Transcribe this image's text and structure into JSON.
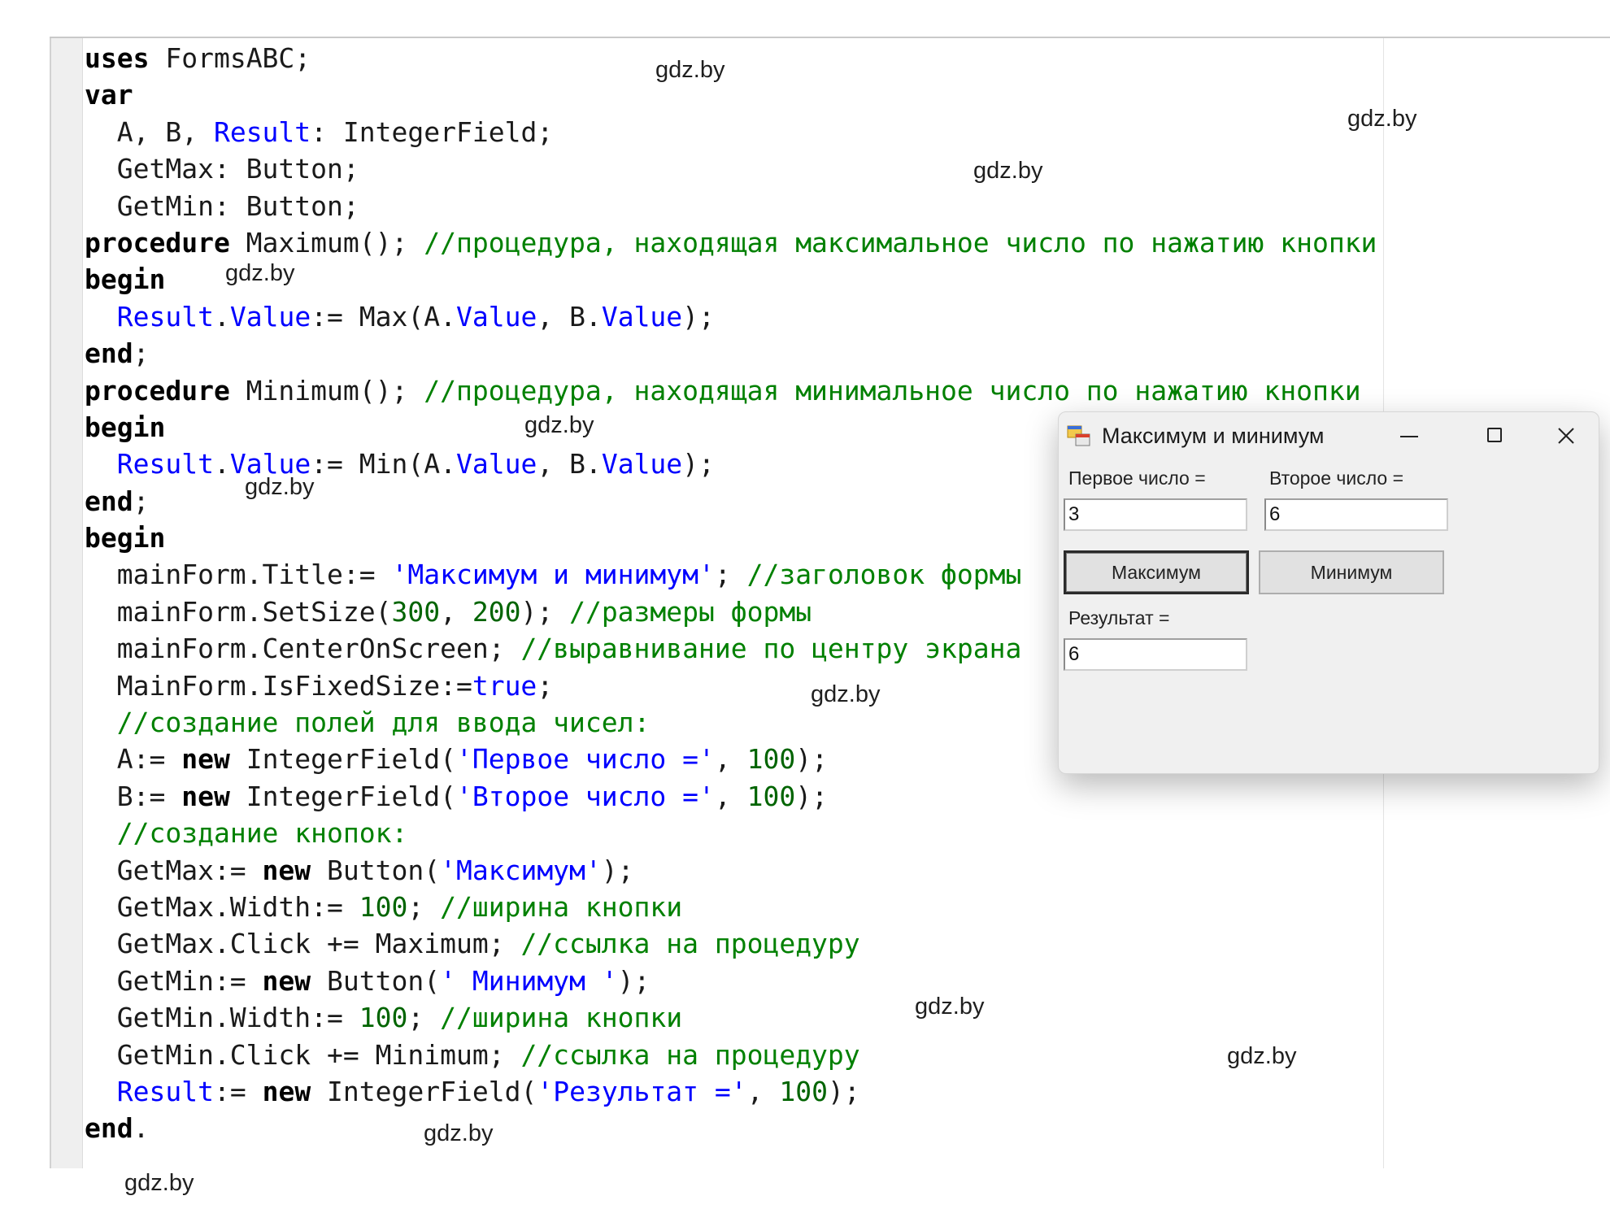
{
  "code_lines": [
    [
      {
        "t": "uses",
        "c": "kw"
      },
      {
        "t": " FormsABC;"
      }
    ],
    [
      {
        "t": "var",
        "c": "kw"
      }
    ],
    [
      {
        "t": "  A, B, "
      },
      {
        "t": "Result",
        "c": "id"
      },
      {
        "t": ": IntegerField;"
      }
    ],
    [
      {
        "t": "  GetMax: Button;"
      }
    ],
    [
      {
        "t": "  GetMin: Button;"
      }
    ],
    [
      {
        "t": "procedure",
        "c": "kw"
      },
      {
        "t": " Maximum(); "
      },
      {
        "t": "//процедура, находящая максимальное число по нажатию кнопки",
        "c": "cm"
      }
    ],
    [
      {
        "t": "begin",
        "c": "kw"
      }
    ],
    [
      {
        "t": "  "
      },
      {
        "t": "Result",
        "c": "id"
      },
      {
        "t": "."
      },
      {
        "t": "Value",
        "c": "id"
      },
      {
        "t": ":= Max(A."
      },
      {
        "t": "Value",
        "c": "id"
      },
      {
        "t": ", B."
      },
      {
        "t": "Value",
        "c": "id"
      },
      {
        "t": ");"
      }
    ],
    [
      {
        "t": "end",
        "c": "kw"
      },
      {
        "t": ";"
      }
    ],
    [
      {
        "t": "procedure",
        "c": "kw"
      },
      {
        "t": " Minimum(); "
      },
      {
        "t": "//процедура, находящая минимальное число по нажатию кнопки",
        "c": "cm"
      }
    ],
    [
      {
        "t": "begin",
        "c": "kw"
      }
    ],
    [
      {
        "t": "  "
      },
      {
        "t": "Result",
        "c": "id"
      },
      {
        "t": "."
      },
      {
        "t": "Value",
        "c": "id"
      },
      {
        "t": ":= Min(A."
      },
      {
        "t": "Value",
        "c": "id"
      },
      {
        "t": ", B."
      },
      {
        "t": "Value",
        "c": "id"
      },
      {
        "t": ");"
      }
    ],
    [
      {
        "t": "end",
        "c": "kw"
      },
      {
        "t": ";"
      }
    ],
    [
      {
        "t": "begin",
        "c": "kw"
      }
    ],
    [
      {
        "t": "  mainForm.Title:= "
      },
      {
        "t": "'Максимум и минимум'",
        "c": "st"
      },
      {
        "t": "; "
      },
      {
        "t": "//заголовок формы",
        "c": "cm"
      }
    ],
    [
      {
        "t": "  mainForm.SetSize("
      },
      {
        "t": "300",
        "c": "nm"
      },
      {
        "t": ", "
      },
      {
        "t": "200",
        "c": "nm"
      },
      {
        "t": "); "
      },
      {
        "t": "//размеры формы",
        "c": "cm"
      }
    ],
    [
      {
        "t": "  mainForm.CenterOnScreen; "
      },
      {
        "t": "//выравнивание по центру экрана",
        "c": "cm"
      }
    ],
    [
      {
        "t": "  MainForm.IsFixedSize:="
      },
      {
        "t": "true",
        "c": "id"
      },
      {
        "t": ";"
      }
    ],
    [
      {
        "t": "  "
      },
      {
        "t": "//создание полей для ввода чисел:",
        "c": "cm"
      }
    ],
    [
      {
        "t": "  A:= "
      },
      {
        "t": "new",
        "c": "kw"
      },
      {
        "t": " IntegerField("
      },
      {
        "t": "'Первое число ='",
        "c": "st"
      },
      {
        "t": ", "
      },
      {
        "t": "100",
        "c": "nm"
      },
      {
        "t": ");"
      }
    ],
    [
      {
        "t": "  B:= "
      },
      {
        "t": "new",
        "c": "kw"
      },
      {
        "t": " IntegerField("
      },
      {
        "t": "'Второе число ='",
        "c": "st"
      },
      {
        "t": ", "
      },
      {
        "t": "100",
        "c": "nm"
      },
      {
        "t": ");"
      }
    ],
    [
      {
        "t": "  "
      },
      {
        "t": "//создание кнопок:",
        "c": "cm"
      }
    ],
    [
      {
        "t": "  GetMax:= "
      },
      {
        "t": "new",
        "c": "kw"
      },
      {
        "t": " Button("
      },
      {
        "t": "'Максимум'",
        "c": "st"
      },
      {
        "t": ");"
      }
    ],
    [
      {
        "t": "  GetMax.Width:= "
      },
      {
        "t": "100",
        "c": "nm"
      },
      {
        "t": "; "
      },
      {
        "t": "//ширина кнопки",
        "c": "cm"
      }
    ],
    [
      {
        "t": "  GetMax.Click += Maximum; "
      },
      {
        "t": "//ссылка на процедуру",
        "c": "cm"
      }
    ],
    [
      {
        "t": "  GetMin:= "
      },
      {
        "t": "new",
        "c": "kw"
      },
      {
        "t": " Button("
      },
      {
        "t": "' Минимум '",
        "c": "st"
      },
      {
        "t": ");"
      }
    ],
    [
      {
        "t": "  GetMin.Width:= "
      },
      {
        "t": "100",
        "c": "nm"
      },
      {
        "t": "; "
      },
      {
        "t": "//ширина кнопки",
        "c": "cm"
      }
    ],
    [
      {
        "t": "  GetMin.Click += Minimum; "
      },
      {
        "t": "//ссылка на процедуру",
        "c": "cm"
      }
    ],
    [
      {
        "t": "  "
      },
      {
        "t": "Result",
        "c": "id"
      },
      {
        "t": ":= "
      },
      {
        "t": "new",
        "c": "kw"
      },
      {
        "t": " IntegerField("
      },
      {
        "t": "'Результат ='",
        "c": "st"
      },
      {
        "t": ", "
      },
      {
        "t": "100",
        "c": "nm"
      },
      {
        "t": ");"
      }
    ],
    [
      {
        "t": "end",
        "c": "kw"
      },
      {
        "t": "."
      }
    ]
  ],
  "watermark": "gdz.by",
  "window": {
    "title": "Максимум и минимум",
    "icon": "winforms-app-icon",
    "controls": {
      "minimize": "minimize-icon",
      "maximize": "maximize-icon",
      "close": "close-icon"
    },
    "first_label": "Первое число =",
    "first_value": "3",
    "second_label": "Второе число =",
    "second_value": "6",
    "max_button": "Максимум",
    "min_button": "Минимум",
    "result_label": "Результат =",
    "result_value": "6"
  },
  "colors": {
    "keyword": "#000000",
    "identifier": "#0000ff",
    "comment": "#008000",
    "string": "#0000ff",
    "number": "#006400",
    "window_bg": "#f0f0f0"
  }
}
